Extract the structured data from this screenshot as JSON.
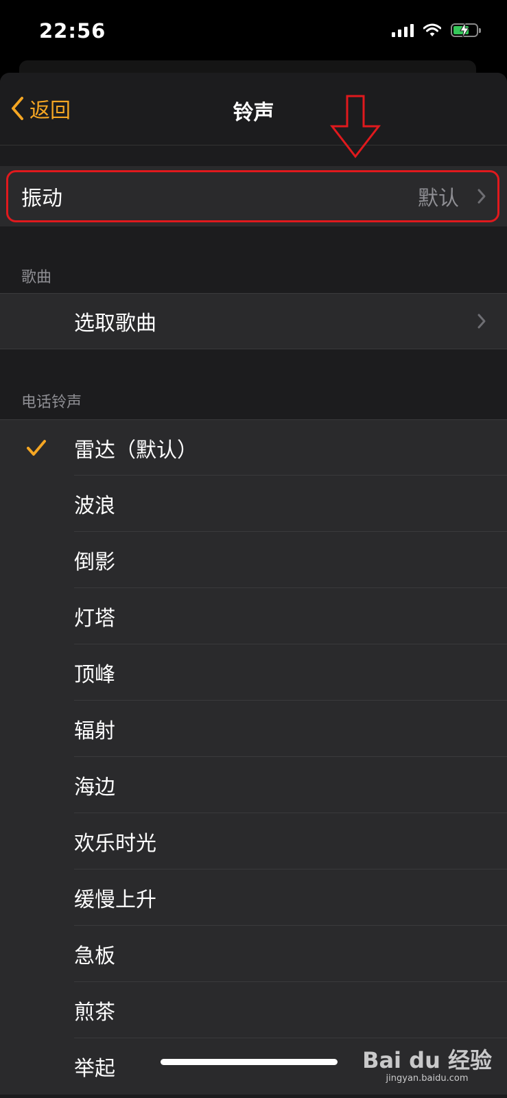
{
  "status_bar": {
    "time": "22:56",
    "signal_icon": "signal-icon",
    "wifi_icon": "wifi-icon",
    "battery_icon": "battery-charging-icon",
    "battery_color": "#35c759"
  },
  "nav": {
    "back_label": "返回",
    "title": "铃声"
  },
  "vibration": {
    "label": "振动",
    "value": "默认"
  },
  "songs_section": {
    "header": "歌曲",
    "pick_label": "选取歌曲"
  },
  "ringtones_section": {
    "header": "电话铃声",
    "items": [
      {
        "label": "雷达（默认）",
        "selected": true
      },
      {
        "label": "波浪",
        "selected": false
      },
      {
        "label": "倒影",
        "selected": false
      },
      {
        "label": "灯塔",
        "selected": false
      },
      {
        "label": "顶峰",
        "selected": false
      },
      {
        "label": "辐射",
        "selected": false
      },
      {
        "label": "海边",
        "selected": false
      },
      {
        "label": "欢乐时光",
        "selected": false
      },
      {
        "label": "缓慢上升",
        "selected": false
      },
      {
        "label": "急板",
        "selected": false
      },
      {
        "label": "煎茶",
        "selected": false
      },
      {
        "label": "举起",
        "selected": false
      }
    ]
  },
  "colors": {
    "accent": "#f5a623",
    "annotation_red": "#e0191d",
    "background": "#1c1c1e",
    "cell": "#2a2a2c"
  },
  "watermark": {
    "brand": "Bai du 经验",
    "url": "jingyan.baidu.com"
  }
}
